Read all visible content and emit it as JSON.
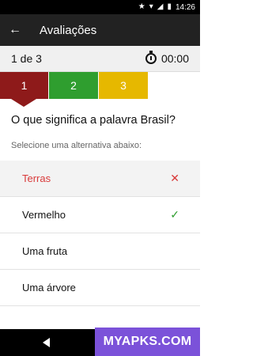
{
  "status_bar": {
    "time": "14:26",
    "icons": [
      "star-icon",
      "wifi-icon",
      "signal-icon",
      "battery-icon"
    ]
  },
  "app_bar": {
    "title": "Avaliações",
    "back_icon": "arrow-back-icon"
  },
  "progress": {
    "position_text": "1 de 3",
    "timer": "00:00",
    "timer_icon": "stopwatch-icon"
  },
  "steps": [
    {
      "label": "1",
      "color": "#8e1a1a",
      "state": "current"
    },
    {
      "label": "2",
      "color": "#2f9e2f",
      "state": "correct"
    },
    {
      "label": "3",
      "color": "#e6b800",
      "state": "pending"
    }
  ],
  "question": {
    "text": "O que significa a palavra Brasil?",
    "hint": "Selecione uma alternativa abaixo:"
  },
  "options": [
    {
      "label": "Terras",
      "state": "wrong",
      "mark": "✕"
    },
    {
      "label": "Vermelho",
      "state": "correct",
      "mark": "✓"
    },
    {
      "label": "Uma fruta",
      "state": "neutral",
      "mark": ""
    },
    {
      "label": "Uma árvore",
      "state": "neutral",
      "mark": ""
    }
  ],
  "nav_bar": {
    "icons": [
      "nav-back-icon",
      "nav-home-icon",
      "nav-recent-icon"
    ]
  },
  "watermark": {
    "text": "MYAPKS.COM"
  }
}
